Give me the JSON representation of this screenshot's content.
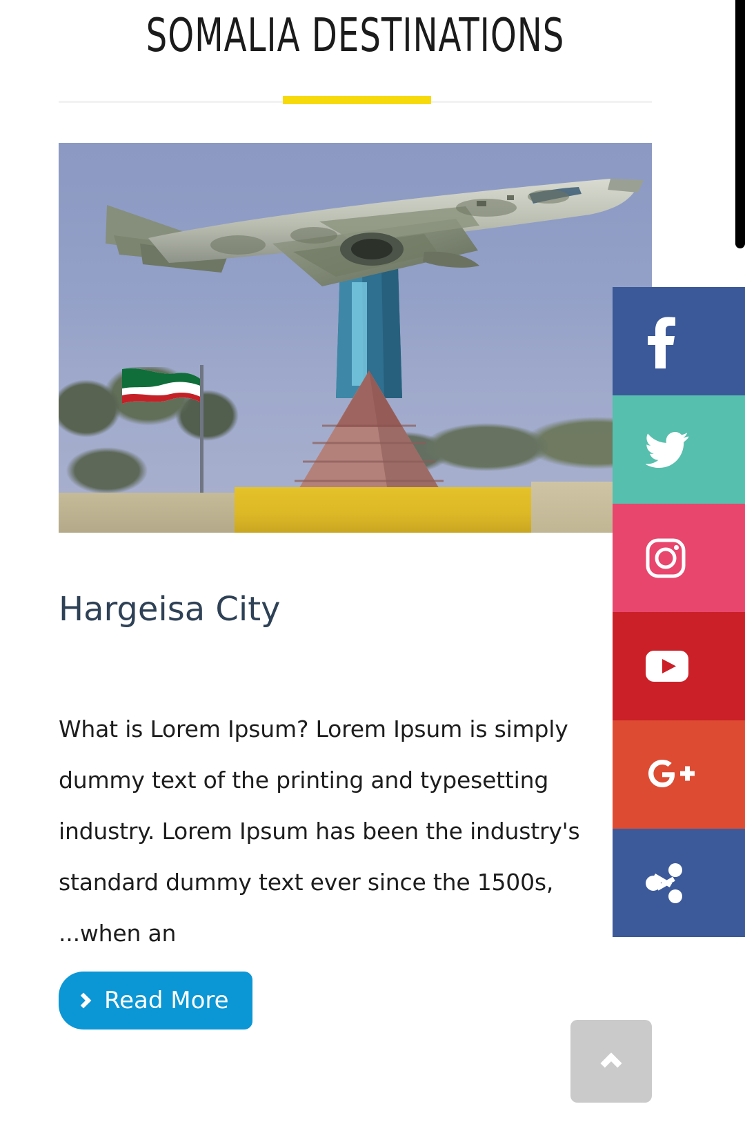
{
  "section": {
    "title": "SOMALIA DESTINATIONS",
    "accent_color": "#f7da0c",
    "divider_color": "#f2f2f2"
  },
  "card": {
    "image_alt": "MiG fighter jet monument with Somaliland flag, Hargeisa",
    "title": "Hargeisa City",
    "body": "What is Lorem Ipsum? Lorem Ipsum is simply dummy text of the printing and typesetting industry. Lorem Ipsum has been the industry's standard dummy text ever since the 1500s, ...when an",
    "read_more_label": "Read More",
    "read_more_icon": "chevron-right-icon",
    "read_more_color": "#0b96d5",
    "title_color": "#2e4156"
  },
  "social": {
    "items": [
      {
        "name": "facebook",
        "icon": "facebook-icon",
        "label": "f",
        "color": "#3b5998"
      },
      {
        "name": "twitter",
        "icon": "twitter-icon",
        "label": "",
        "color": "#56bfad"
      },
      {
        "name": "instagram",
        "icon": "instagram-icon",
        "label": "",
        "color": "#e8466d"
      },
      {
        "name": "youtube",
        "icon": "youtube-icon",
        "label": "",
        "color": "#cb2027"
      },
      {
        "name": "google-plus",
        "icon": "google-plus-icon",
        "label": "G+",
        "color": "#dd4b32"
      },
      {
        "name": "share",
        "icon": "share-icon",
        "label": "",
        "color": "#3c5a9a"
      }
    ]
  },
  "scroll_top": {
    "icon": "chevron-up-icon",
    "color": "#cacaca"
  },
  "scrollbar": {
    "thumb_color": "#000000"
  }
}
